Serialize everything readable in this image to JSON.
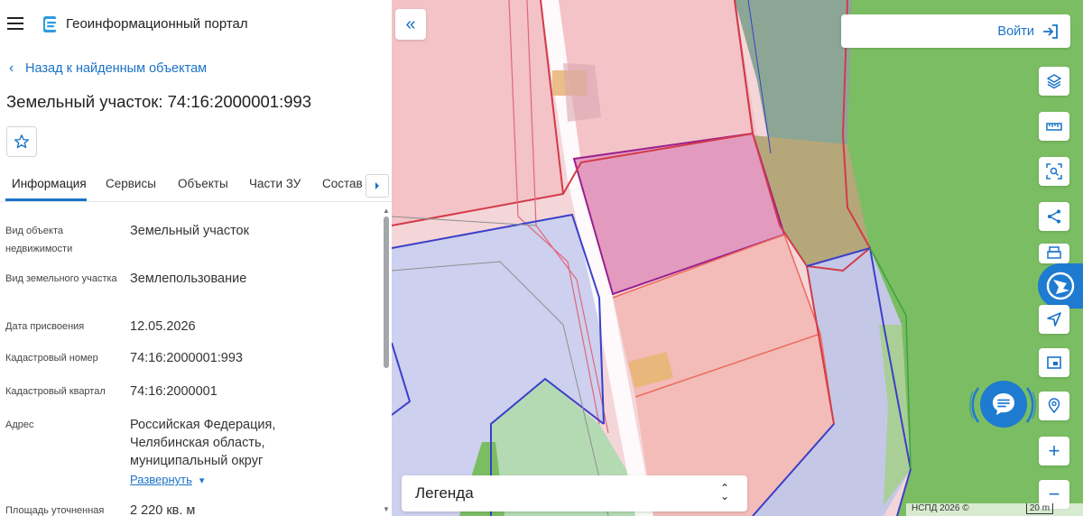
{
  "header": {
    "title": "Геоинформационный портал"
  },
  "nav": {
    "back_label": "Назад к найденным объектам"
  },
  "object": {
    "title": "Земельный участок: 74:16:2000001:993"
  },
  "tabs": [
    {
      "label": "Информация",
      "active": true
    },
    {
      "label": "Сервисы"
    },
    {
      "label": "Объекты"
    },
    {
      "label": "Части ЗУ"
    },
    {
      "label": "Состав"
    }
  ],
  "info": {
    "rows": [
      {
        "label": "Вид объекта недвижимости",
        "value": "Земельный участок"
      },
      {
        "label": "Вид земельного участка",
        "value": "Землепользование"
      },
      {
        "label": "Дата присвоения",
        "value": "12.05.2026"
      },
      {
        "label": "Кадастровый номер",
        "value": "74:16:2000001:993"
      },
      {
        "label": "Кадастровый квартал",
        "value": "74:16:2000001"
      },
      {
        "label": "Адрес",
        "value": "Российская Федерация, Челябинская область, муниципальный округ"
      },
      {
        "label": "Площадь уточненная",
        "value": "2 220 кв. м"
      }
    ],
    "expand_label": "Развернуть"
  },
  "map": {
    "login_label": "Войти",
    "legend_label": "Легенда",
    "attribution": "НСПД 2026 ©",
    "scale_label": "20 m"
  },
  "colors": {
    "accent": "#1a73c8",
    "parcel_fill": "#f3c3c7",
    "parcel_stroke": "#d23b4a",
    "selected_fill": "#e29bbf",
    "selected_stroke": "#9b1f8e",
    "quarter_stroke": "#3b3fc8",
    "forest": "#7bbd63"
  },
  "icons": {
    "menu": "hamburger-icon",
    "logo": "portal-logo-icon",
    "back": "chevron-left-icon",
    "favorite": "star-icon",
    "tabs_next": "chevron-right-icon",
    "collapse": "double-chevron-left-icon",
    "login": "login-arrow-icon",
    "layers": "layers-icon",
    "ruler": "ruler-icon",
    "select_area": "area-search-icon",
    "share": "share-icon",
    "print": "print-icon",
    "locate": "navigation-arrow-icon",
    "minimap": "minimap-icon",
    "geo_search": "location-search-icon",
    "zoom_in": "plus-icon",
    "zoom_out": "minus-icon",
    "chat": "chat-icon"
  }
}
